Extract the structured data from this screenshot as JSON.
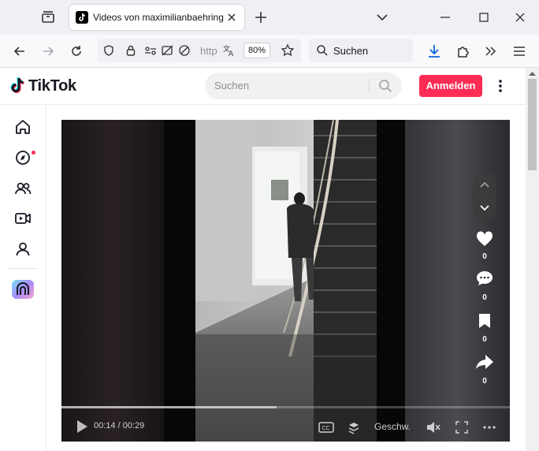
{
  "browser": {
    "tab": {
      "title": "Videos von maximilianbaehring"
    },
    "url_text": "http",
    "zoom": "80%",
    "search_label": "Suchen"
  },
  "tiktok": {
    "logo": "TikTok",
    "search_placeholder": "Suchen",
    "login_label": "Anmelden",
    "sidebar": [
      "home-icon",
      "explore-icon",
      "following-icon",
      "live-icon",
      "profile-icon",
      "feedback-icon"
    ],
    "video": {
      "time": "00:14 / 00:29",
      "progress": 0.48,
      "speed_label": "Geschw.",
      "like_count": "0",
      "comment_count": "0",
      "bookmark_count": "0",
      "share_count": "0"
    },
    "colors": {
      "accent": "#fe2c55",
      "notification_dot": "#fe2c55"
    }
  }
}
